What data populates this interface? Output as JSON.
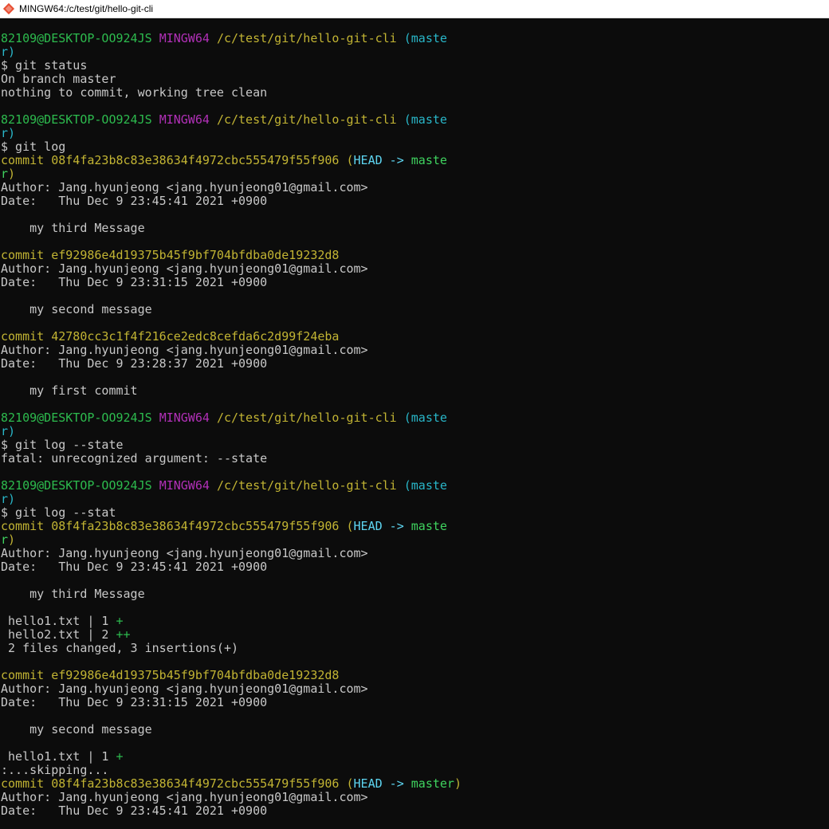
{
  "window": {
    "title": "MINGW64:/c/test/git/hello-git-cli",
    "icon": "git-bash-icon"
  },
  "colors": {
    "background": "#0c0c0c",
    "default": "#c8c8c8",
    "green": "#2dbb4e",
    "magenta": "#b230b8",
    "yellow": "#c2b433",
    "cyan": "#29b7c9",
    "bright_cyan": "#5ed6f2",
    "light_green": "#3fd35f"
  },
  "terminal_lines": [
    [
      [
        "green",
        "82109@DESKTOP-OO924JS "
      ],
      [
        "magenta",
        "MINGW64 "
      ],
      [
        "yellow",
        "/c/test/git/hello-git-cli "
      ],
      [
        "cyan",
        "(maste"
      ]
    ],
    [
      [
        "cyan",
        "r)"
      ]
    ],
    [
      [
        "default",
        "$ git status"
      ]
    ],
    [
      [
        "default",
        "On branch master"
      ]
    ],
    [
      [
        "default",
        "nothing to commit, working tree clean"
      ]
    ],
    [],
    [
      [
        "green",
        "82109@DESKTOP-OO924JS "
      ],
      [
        "magenta",
        "MINGW64 "
      ],
      [
        "yellow",
        "/c/test/git/hello-git-cli "
      ],
      [
        "cyan",
        "(maste"
      ]
    ],
    [
      [
        "cyan",
        "r)"
      ]
    ],
    [
      [
        "default",
        "$ git log"
      ]
    ],
    [
      [
        "yellow",
        "commit 08f4fa23b8c83e38634f4972cbc555479f55f906 ("
      ],
      [
        "cyanb",
        "HEAD -> "
      ],
      [
        "lgreen",
        "maste"
      ]
    ],
    [
      [
        "lgreen",
        "r"
      ],
      [
        "yellow",
        ")"
      ]
    ],
    [
      [
        "default",
        "Author: Jang.hyunjeong <jang.hyunjeong01@gmail.com>"
      ]
    ],
    [
      [
        "default",
        "Date:   Thu Dec 9 23:45:41 2021 +0900"
      ]
    ],
    [],
    [
      [
        "default",
        "    my third Message"
      ]
    ],
    [],
    [
      [
        "yellow",
        "commit ef92986e4d19375b45f9bf704bfdba0de19232d8"
      ]
    ],
    [
      [
        "default",
        "Author: Jang.hyunjeong <jang.hyunjeong01@gmail.com>"
      ]
    ],
    [
      [
        "default",
        "Date:   Thu Dec 9 23:31:15 2021 +0900"
      ]
    ],
    [],
    [
      [
        "default",
        "    my second message"
      ]
    ],
    [],
    [
      [
        "yellow",
        "commit 42780cc3c1f4f216ce2edc8cefda6c2d99f24eba"
      ]
    ],
    [
      [
        "default",
        "Author: Jang.hyunjeong <jang.hyunjeong01@gmail.com>"
      ]
    ],
    [
      [
        "default",
        "Date:   Thu Dec 9 23:28:37 2021 +0900"
      ]
    ],
    [],
    [
      [
        "default",
        "    my first commit"
      ]
    ],
    [],
    [
      [
        "green",
        "82109@DESKTOP-OO924JS "
      ],
      [
        "magenta",
        "MINGW64 "
      ],
      [
        "yellow",
        "/c/test/git/hello-git-cli "
      ],
      [
        "cyan",
        "(maste"
      ]
    ],
    [
      [
        "cyan",
        "r)"
      ]
    ],
    [
      [
        "default",
        "$ git log --state"
      ]
    ],
    [
      [
        "default",
        "fatal: unrecognized argument: --state"
      ]
    ],
    [],
    [
      [
        "green",
        "82109@DESKTOP-OO924JS "
      ],
      [
        "magenta",
        "MINGW64 "
      ],
      [
        "yellow",
        "/c/test/git/hello-git-cli "
      ],
      [
        "cyan",
        "(maste"
      ]
    ],
    [
      [
        "cyan",
        "r)"
      ]
    ],
    [
      [
        "default",
        "$ git log --stat"
      ]
    ],
    [
      [
        "yellow",
        "commit 08f4fa23b8c83e38634f4972cbc555479f55f906 ("
      ],
      [
        "cyanb",
        "HEAD -> "
      ],
      [
        "lgreen",
        "maste"
      ]
    ],
    [
      [
        "lgreen",
        "r"
      ],
      [
        "yellow",
        ")"
      ]
    ],
    [
      [
        "default",
        "Author: Jang.hyunjeong <jang.hyunjeong01@gmail.com>"
      ]
    ],
    [
      [
        "default",
        "Date:   Thu Dec 9 23:45:41 2021 +0900"
      ]
    ],
    [],
    [
      [
        "default",
        "    my third Message"
      ]
    ],
    [],
    [
      [
        "default",
        " hello1.txt | 1 "
      ],
      [
        "green",
        "+"
      ]
    ],
    [
      [
        "default",
        " hello2.txt | 2 "
      ],
      [
        "green",
        "++"
      ]
    ],
    [
      [
        "default",
        " 2 files changed, 3 insertions(+)"
      ]
    ],
    [],
    [
      [
        "yellow",
        "commit ef92986e4d19375b45f9bf704bfdba0de19232d8"
      ]
    ],
    [
      [
        "default",
        "Author: Jang.hyunjeong <jang.hyunjeong01@gmail.com>"
      ]
    ],
    [
      [
        "default",
        "Date:   Thu Dec 9 23:31:15 2021 +0900"
      ]
    ],
    [],
    [
      [
        "default",
        "    my second message"
      ]
    ],
    [],
    [
      [
        "default",
        " hello1.txt | 1 "
      ],
      [
        "green",
        "+"
      ]
    ],
    [
      [
        "default",
        ":...skipping..."
      ]
    ],
    [
      [
        "yellow",
        "commit 08f4fa23b8c83e38634f4972cbc555479f55f906 ("
      ],
      [
        "cyanb",
        "HEAD -> "
      ],
      [
        "lgreen",
        "master"
      ],
      [
        "yellow",
        ")"
      ]
    ],
    [
      [
        "default",
        "Author: Jang.hyunjeong <jang.hyunjeong01@gmail.com>"
      ]
    ],
    [
      [
        "default",
        "Date:   Thu Dec 9 23:45:41 2021 +0900"
      ]
    ]
  ]
}
